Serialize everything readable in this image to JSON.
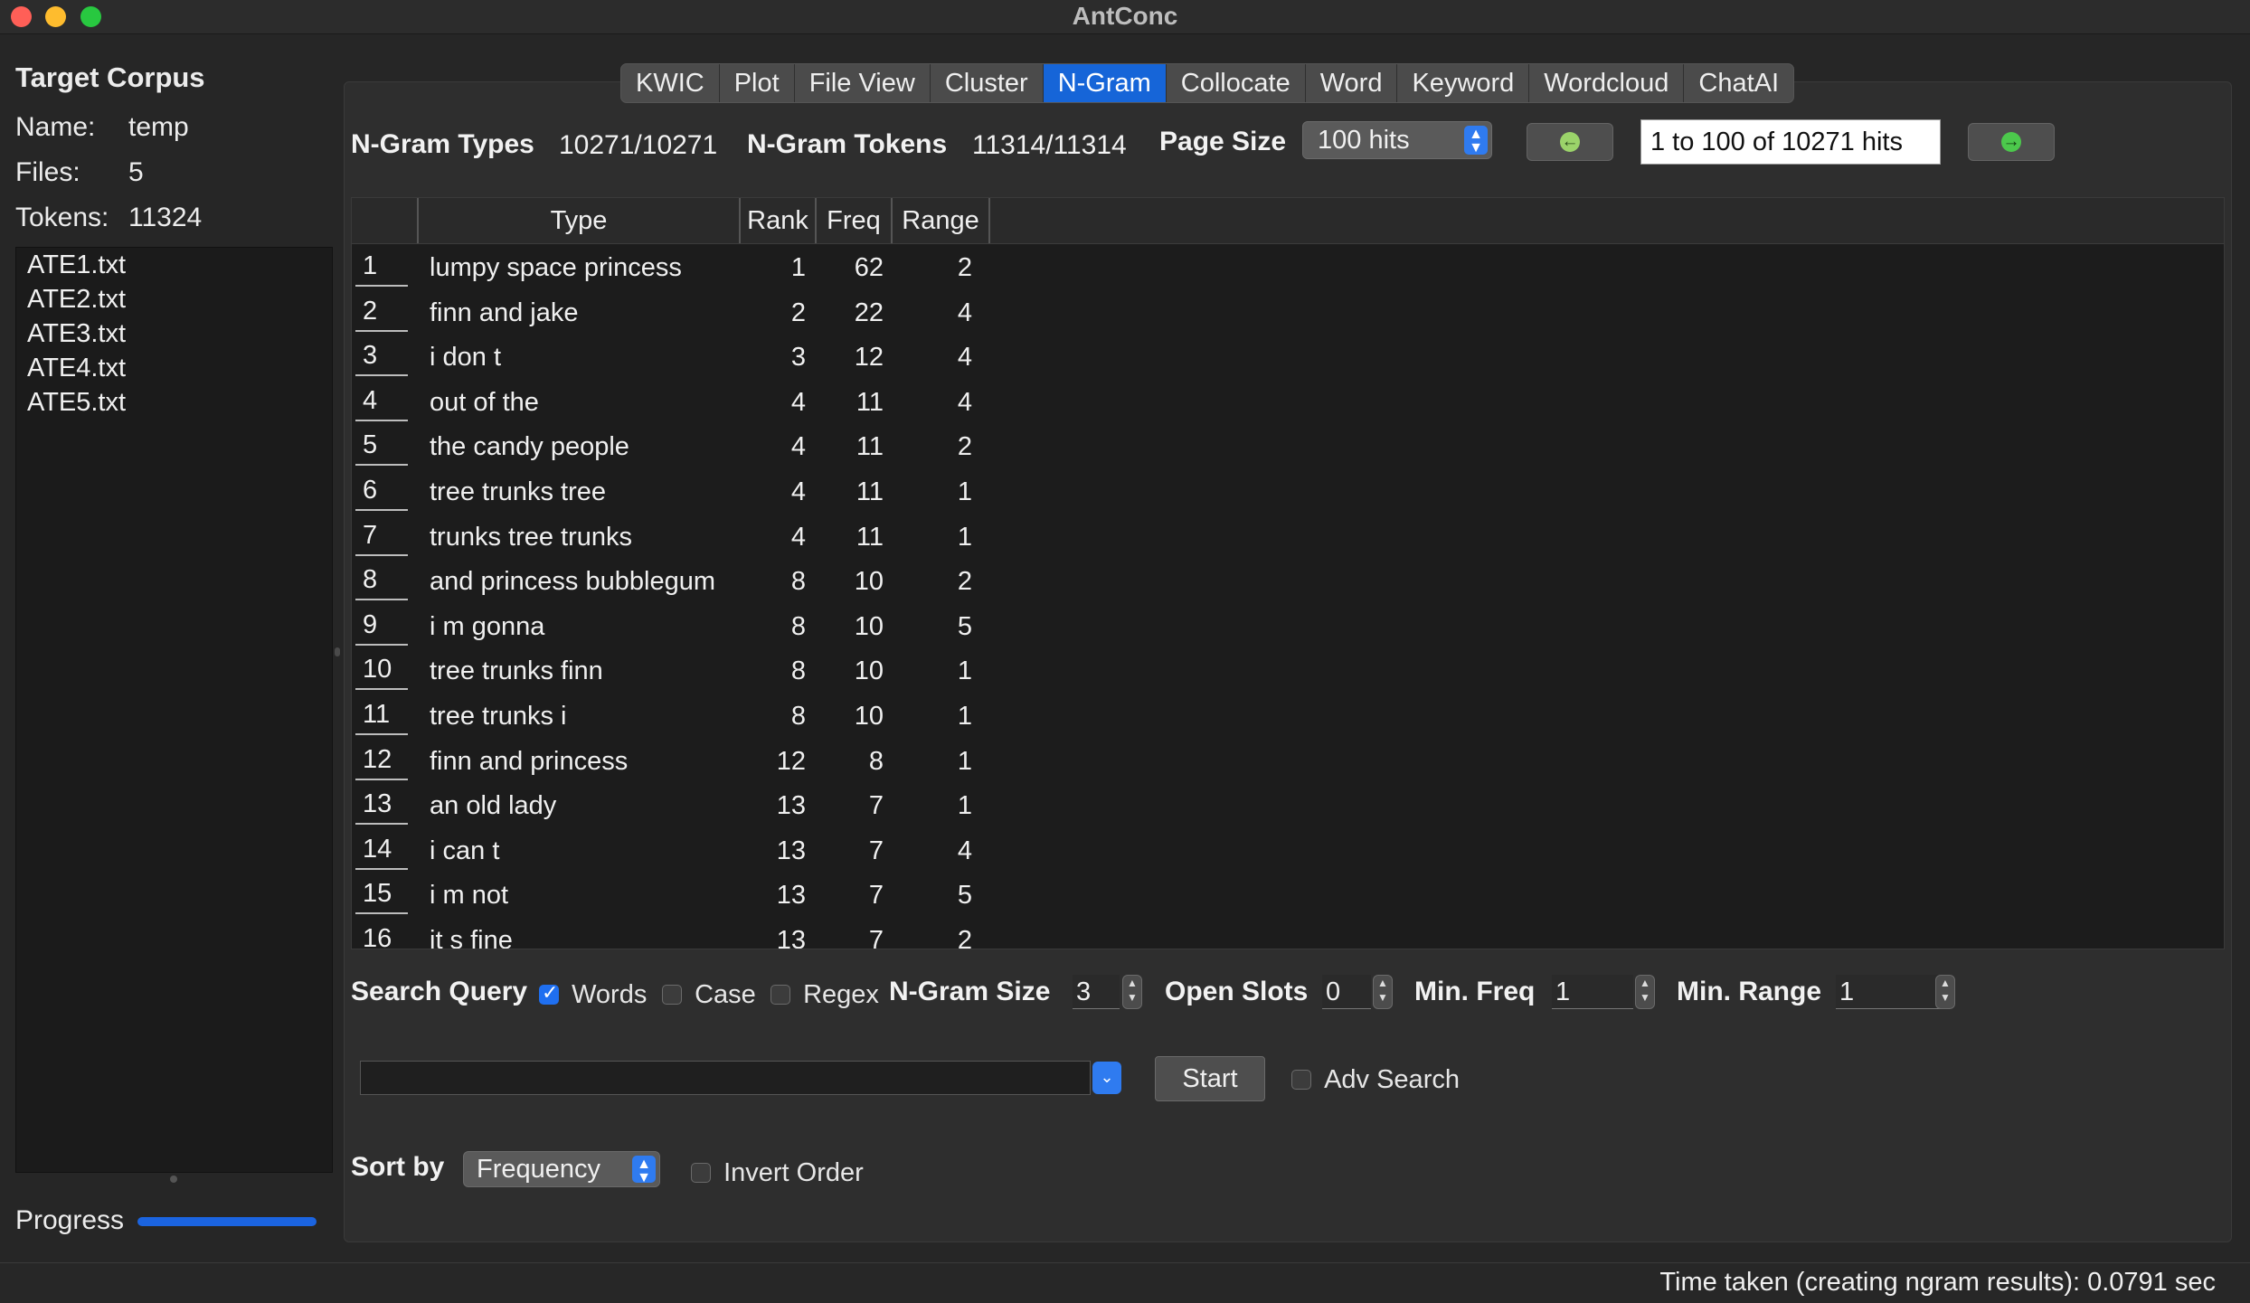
{
  "window": {
    "title": "AntConc"
  },
  "left_panel": {
    "heading": "Target Corpus",
    "name_label": "Name:",
    "name_value": "temp",
    "files_label": "Files:",
    "files_value": "5",
    "tokens_label": "Tokens:",
    "tokens_value": "11324",
    "files": [
      "ATE1.txt",
      "ATE2.txt",
      "ATE3.txt",
      "ATE4.txt",
      "ATE5.txt"
    ],
    "progress_label": "Progress",
    "progress_fraction": 1.0
  },
  "tabs": [
    "KWIC",
    "Plot",
    "File View",
    "Cluster",
    "N-Gram",
    "Collocate",
    "Word",
    "Keyword",
    "Wordcloud",
    "ChatAI"
  ],
  "active_tab": "N-Gram",
  "header": {
    "types_label": "N-Gram Types",
    "types_value": "10271/10271",
    "tokens_label": "N-Gram Tokens",
    "tokens_value": "11314/11314",
    "page_size_label": "Page Size",
    "page_size_value": "100 hits",
    "hits_range": "1 to 100 of 10271 hits"
  },
  "table": {
    "columns": [
      "Type",
      "Rank",
      "Freq",
      "Range"
    ],
    "rows": [
      [
        "1",
        "lumpy space princess",
        "1",
        "62",
        "2"
      ],
      [
        "2",
        "finn and jake",
        "2",
        "22",
        "4"
      ],
      [
        "3",
        "i don t",
        "3",
        "12",
        "4"
      ],
      [
        "4",
        "out of the",
        "4",
        "11",
        "4"
      ],
      [
        "5",
        "the candy people",
        "4",
        "11",
        "2"
      ],
      [
        "6",
        "tree trunks tree",
        "4",
        "11",
        "1"
      ],
      [
        "7",
        "trunks tree trunks",
        "4",
        "11",
        "1"
      ],
      [
        "8",
        "and princess bubblegum",
        "8",
        "10",
        "2"
      ],
      [
        "9",
        "i m gonna",
        "8",
        "10",
        "5"
      ],
      [
        "10",
        "tree trunks finn",
        "8",
        "10",
        "1"
      ],
      [
        "11",
        "tree trunks i",
        "8",
        "10",
        "1"
      ],
      [
        "12",
        "finn and princess",
        "12",
        "8",
        "1"
      ],
      [
        "13",
        "an old lady",
        "13",
        "7",
        "1"
      ],
      [
        "14",
        "i can t",
        "13",
        "7",
        "4"
      ],
      [
        "15",
        "i m not",
        "13",
        "7",
        "5"
      ],
      [
        "16",
        "it s fine",
        "13",
        "7",
        "2"
      ]
    ]
  },
  "search": {
    "query_label": "Search Query",
    "words_label": "Words",
    "words_checked": true,
    "case_label": "Case",
    "case_checked": false,
    "regex_label": "Regex",
    "regex_checked": false,
    "ngram_size_label": "N-Gram Size",
    "ngram_size_value": "3",
    "open_slots_label": "Open Slots",
    "open_slots_value": "0",
    "min_freq_label": "Min. Freq",
    "min_freq_value": "1",
    "min_range_label": "Min. Range",
    "min_range_value": "1",
    "query_value": "",
    "start_label": "Start",
    "adv_search_label": "Adv Search",
    "adv_search_checked": false
  },
  "sort": {
    "label": "Sort by",
    "value": "Frequency",
    "invert_label": "Invert Order",
    "invert_checked": false
  },
  "status": {
    "text": "Time taken (creating ngram results):  0.0791 sec"
  },
  "colors": {
    "accent": "#1665d8",
    "traffic_red": "#ff5f57",
    "traffic_yellow": "#febc2e",
    "traffic_green": "#28c840",
    "nav_prev_arrow": "#9bd36a",
    "nav_next_arrow": "#4cc84c"
  }
}
